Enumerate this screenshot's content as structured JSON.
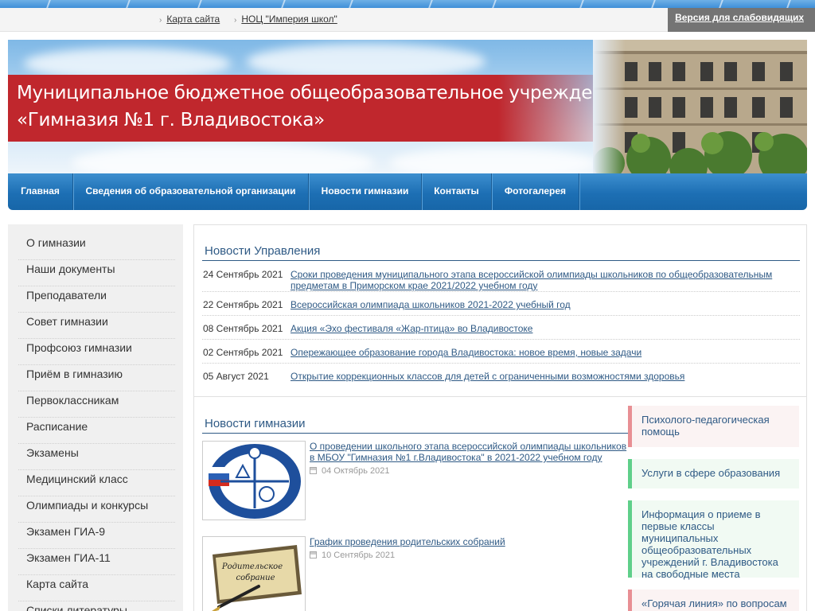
{
  "topbar": {
    "links": [
      "Карта сайта",
      "НОЦ \"Империя школ\""
    ],
    "vision_button": "Версия для слабовидящих"
  },
  "header": {
    "title_line1": "Муниципальное бюджетное общеобразовательное учреждение",
    "title_line2": "«Гимназия №1 г. Владивостока»"
  },
  "nav": {
    "items": [
      "Главная",
      "Сведения об образовательной организации",
      "Новости гимназии",
      "Контакты",
      "Фотогалерея"
    ]
  },
  "sidebar": {
    "items": [
      "О гимназии",
      "Наши документы",
      "Преподаватели",
      "Совет гимназии",
      "Профсоюз гимназии",
      "Приём в гимназию",
      "Первоклассникам",
      "Расписание",
      "Экзамены",
      "Медицинский класс",
      "Олимпиады и конкурсы",
      "Экзамен ГИА-9",
      "Экзамен ГИА-11",
      "Карта сайта",
      "Списки литературы"
    ]
  },
  "admin_news": {
    "title": "Новости Управления",
    "items": [
      {
        "date": "24 Сентябрь 2021",
        "title": "Сроки проведения муниципального этапа всероссийской олимпиады школьников по общеобразовательным предметам в Приморском крае 2021/2022 учебном году"
      },
      {
        "date": "22 Сентябрь 2021",
        "title": "Всероссийская олимпиада школьников 2021-2022 учебный год"
      },
      {
        "date": "08 Сентябрь 2021",
        "title": "Акция «Эхо фестиваля «Жар-птица» во Владивостоке"
      },
      {
        "date": "02 Сентябрь 2021",
        "title": "Опережающее образование города Владивостока: новое время, новые задачи"
      },
      {
        "date": "05 Август 2021",
        "title": "Открытие коррекционных классов для детей с ограниченными возможностями здоровья"
      }
    ]
  },
  "gym_news": {
    "title": "Новости гимназии",
    "items": [
      {
        "title": "О проведении школьного этапа всероссийской олимпиады школьников в МБОУ \"Гимназия №1 г.Владивостока\" в 2021-2022 учебном году",
        "date": "04 Октябрь 2021",
        "image_text": "ВСЕРОССИЙСКАЯ ОЛИМПИАДА"
      },
      {
        "title": "График проведения родительских собраний",
        "date": "10 Сентябрь 2021",
        "image_text": "Родительское собрание"
      }
    ]
  },
  "right_banners": [
    {
      "text": "Психолого-педагогическая помощь",
      "color": "#e88f94"
    },
    {
      "text": "Услуги в сфере образования",
      "color": "#5fcf8a"
    },
    {
      "text": "Информация о приеме в первые классы муниципальных общеобразовательных учреждений г. Владивостока на свободные места",
      "color": "#5fcf8a"
    },
    {
      "text": "«Горячая линия» по вопросам",
      "color": "#e88f94"
    }
  ]
}
